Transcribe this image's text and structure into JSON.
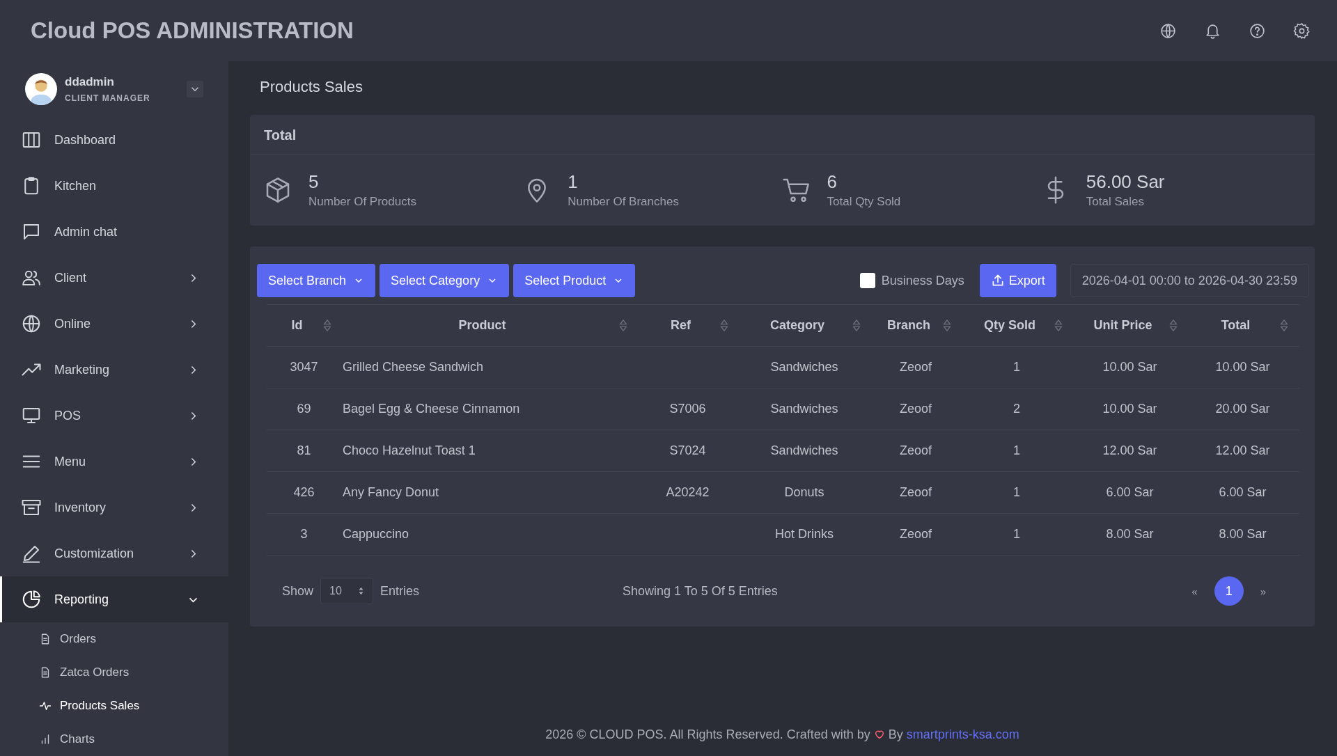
{
  "header": {
    "title": "Cloud POS ADMINISTRATION"
  },
  "user": {
    "name": "ddadmin",
    "role": "CLIENT MANAGER"
  },
  "sidebar": {
    "items": [
      {
        "label": "Dashboard",
        "kind": "dashboard",
        "selected": false
      },
      {
        "label": "Kitchen",
        "kind": "clipboard",
        "selected": false
      },
      {
        "label": "Admin chat",
        "kind": "chat",
        "selected": false
      },
      {
        "label": "Client",
        "kind": "users",
        "expanded": false,
        "selected": false
      },
      {
        "label": "Online",
        "kind": "globe",
        "expanded": false,
        "selected": false
      },
      {
        "label": "Marketing",
        "kind": "trend",
        "expanded": false,
        "selected": false
      },
      {
        "label": "POS",
        "kind": "monitor",
        "expanded": false,
        "selected": false
      },
      {
        "label": "Menu",
        "kind": "lines",
        "expanded": false,
        "selected": false
      },
      {
        "label": "Inventory",
        "kind": "archive",
        "expanded": false,
        "selected": false
      },
      {
        "label": "Customization",
        "kind": "pen",
        "expanded": false,
        "selected": false
      },
      {
        "label": "Reporting",
        "kind": "pie",
        "expanded": true,
        "selected": true,
        "children": [
          {
            "label": "Orders",
            "kind": "doc",
            "selected": false
          },
          {
            "label": "Zatca Orders",
            "kind": "doc",
            "selected": false
          },
          {
            "label": "Products Sales",
            "kind": "pulse",
            "selected": true
          },
          {
            "label": "Charts",
            "kind": "bars",
            "selected": false
          }
        ]
      }
    ]
  },
  "page": {
    "title": "Products Sales"
  },
  "totals": {
    "title": "Total",
    "stats": [
      {
        "kind": "box",
        "value": "5",
        "label": "Number Of Products"
      },
      {
        "kind": "pin",
        "value": "1",
        "label": "Number Of Branches"
      },
      {
        "kind": "cart",
        "value": "6",
        "label": "Total Qty Sold"
      },
      {
        "kind": "dollar",
        "value": "56.00 Sar",
        "label": "Total Sales"
      }
    ]
  },
  "filters": {
    "dropdowns": [
      "Select Branch",
      "Select Category",
      "Select Product"
    ],
    "business_days": {
      "label": "Business Days",
      "checked": false
    },
    "export": "Export",
    "date_range": "2026-04-01 00:00 to 2026-04-30 23:59"
  },
  "table": {
    "columns": [
      "Id",
      "Product",
      "Ref",
      "Category",
      "Branch",
      "Qty Sold",
      "Unit Price",
      "Total"
    ],
    "rows": [
      [
        "3047",
        "Grilled Cheese Sandwich",
        "",
        "Sandwiches",
        "Zeoof",
        "1",
        "10.00 Sar",
        "10.00 Sar"
      ],
      [
        "69",
        "Bagel Egg & Cheese Cinnamon",
        "S7006",
        "Sandwiches",
        "Zeoof",
        "2",
        "10.00 Sar",
        "20.00 Sar"
      ],
      [
        "81",
        "Choco Hazelnut Toast 1",
        "S7024",
        "Sandwiches",
        "Zeoof",
        "1",
        "12.00 Sar",
        "12.00 Sar"
      ],
      [
        "426",
        "Any Fancy Donut",
        "A20242",
        "Donuts",
        "Zeoof",
        "1",
        "6.00 Sar",
        "6.00 Sar"
      ],
      [
        "3",
        "Cappuccino",
        "",
        "Hot Drinks",
        "Zeoof",
        "1",
        "8.00 Sar",
        "8.00 Sar"
      ]
    ]
  },
  "pagination": {
    "show": "Show",
    "page_size": "10",
    "entries": "Entries",
    "info": "Showing 1 To 5 Of 5 Entries",
    "prev": "«",
    "pages": [
      {
        "label": "1",
        "selected": true
      }
    ],
    "next": "»"
  },
  "footer": {
    "text": "2026 © CLOUD POS. All Rights Reserved. Crafted with by",
    "by": "By",
    "link": "smartprints-ksa.com"
  }
}
